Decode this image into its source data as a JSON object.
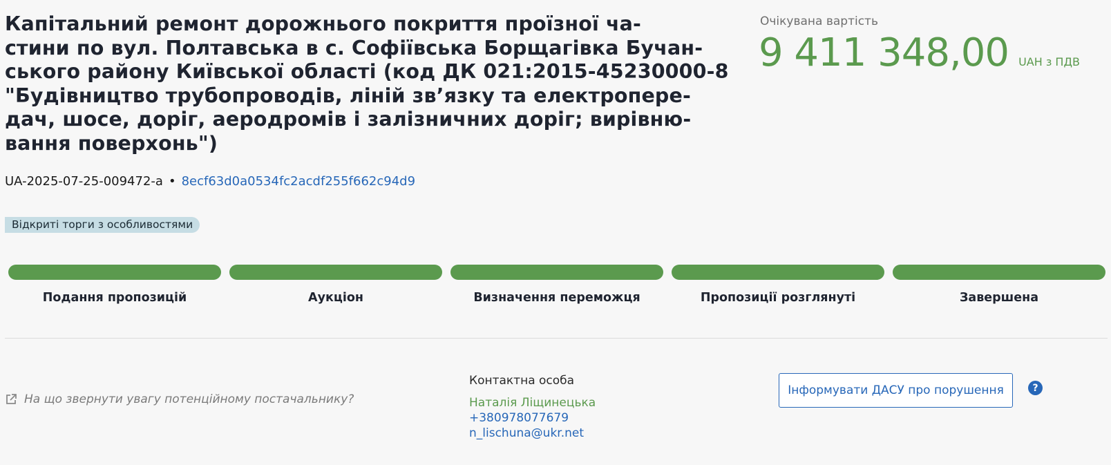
{
  "tender": {
    "title_lines": [
      "Капітальний ремонт дорожнього покриття проїзної ча-",
      "стини по вул. Полтавська в с. Софіївська Борщагівка Бучан-",
      "ського району Київської області (код ДК 021:2015-45230000-8",
      "\"Будівництво трубопроводів, ліній зв’язку та електропере-",
      "дач, шосе, доріг, аеродромів і залізничних доріг; вирівню-",
      "вання поверхонь\")"
    ],
    "tender_id": "UA-2025-07-25-009472-a",
    "separator": "•",
    "hash_id": "8ecf63d0a0534fc2acdf255f662c94d9",
    "procedure_badge": "Відкриті торги з особливостями"
  },
  "price": {
    "label": "Очікувана вартість",
    "value": "9 411 348,00",
    "currency": "UAH з ПДВ"
  },
  "stages": [
    {
      "label": "Подання пропозицій",
      "progress": 1.0
    },
    {
      "label": "Аукціон",
      "progress": 1.0
    },
    {
      "label": "Визначення переможця",
      "progress": 1.0
    },
    {
      "label": "Пропозиції розглянуті",
      "progress": 1.0
    },
    {
      "label": "Завершена",
      "progress": 1.0
    }
  ],
  "hint": {
    "icon": "external-link-icon",
    "text": "На що звернути увагу потенційному постачальнику?"
  },
  "contact": {
    "heading": "Контактна особа",
    "name": "Наталія Ліщинецька",
    "phone": "+380978077679",
    "email": "n_lischuna@ukr.net"
  },
  "actions": {
    "report_label": "Інформувати ДАСУ про порушення",
    "help_icon": "question-circle-icon",
    "help_glyph": "?"
  },
  "colors": {
    "accent_green": "#5b9a4e",
    "link_blue": "#2767b8",
    "badge_bg": "#c6dde4"
  }
}
